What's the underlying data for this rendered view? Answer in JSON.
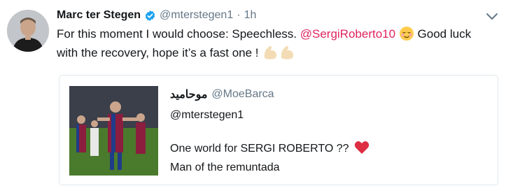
{
  "tweet": {
    "author_name": "Marc ter Stegen",
    "handle": "@mterstegen1",
    "separator": "·",
    "time": "1h",
    "text_part1": "For this moment I would choose: Speechless.",
    "mention": "@SergiRoberto10",
    "text_part2": "Good luck",
    "text_line2": "with the recovery, hope it’s a fast one !",
    "icons": [
      "verified-badge-icon",
      "chevron-down-icon",
      "relieved-face-emoji-icon",
      "flexed-biceps-emoji-icon",
      "red-heart-emoji-icon"
    ]
  },
  "quoted_tweet": {
    "author_name": "موحاميد",
    "handle": "@MoeBarca",
    "reply_to": "@mterstegen1",
    "line1": "One world for SERGI ROBERTO ??",
    "line2": "Man of the remuntada"
  },
  "colors": {
    "mention": "#e0245e",
    "verified": "#1da1f2",
    "secondary_text": "#657786",
    "border": "#e1e8ed"
  }
}
